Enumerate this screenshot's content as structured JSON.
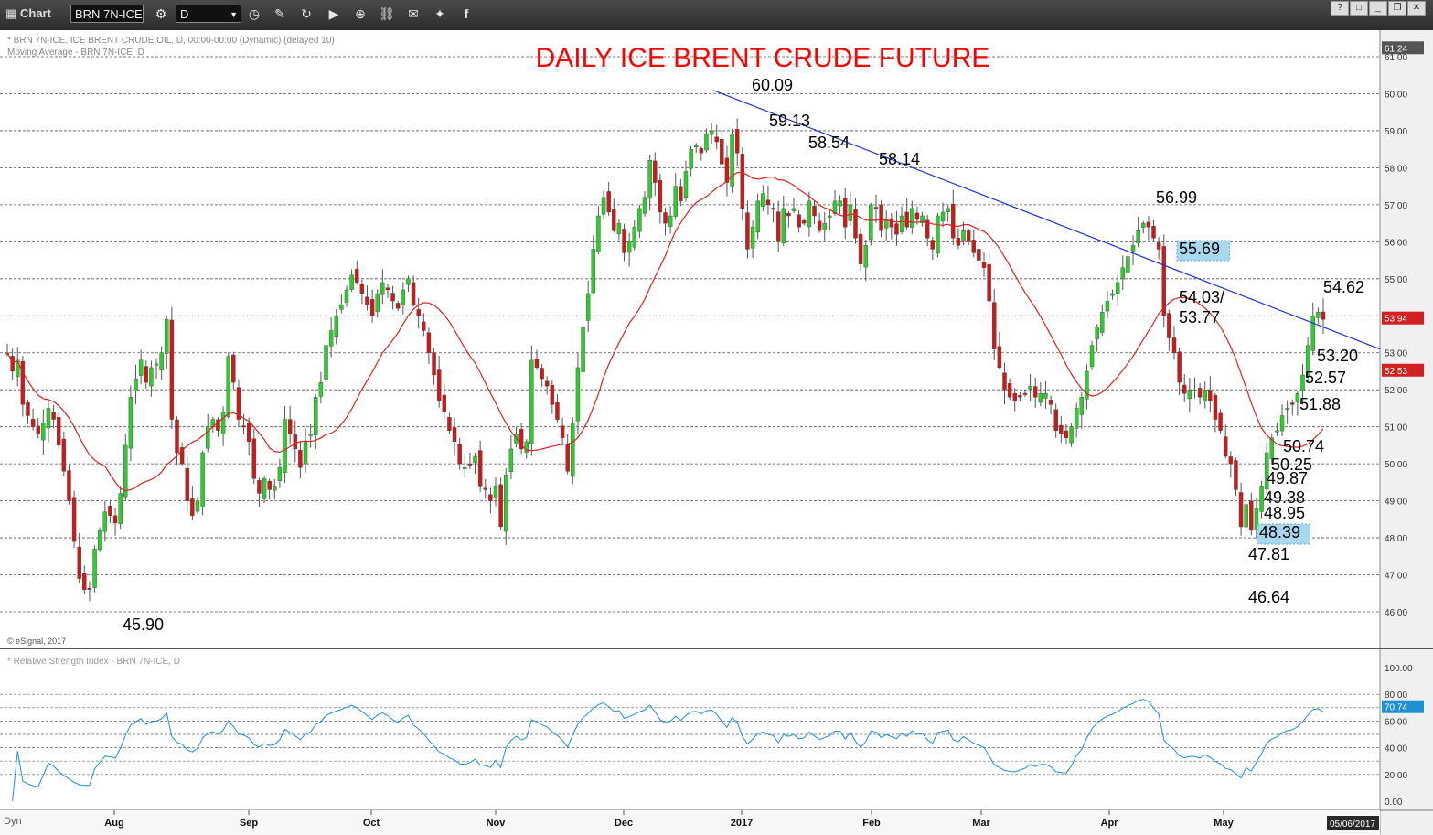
{
  "toolbar": {
    "app_label": "Chart",
    "symbol_value": "BRN 7N-ICE",
    "interval_value": "D"
  },
  "header": {
    "line1": "* BRN 7N-ICE, ICE BRENT CRUDE OIL, D, 00:00-00:00 (Dynamic) (delayed 10)",
    "line2": "Moving Average - BRN 7N-ICE, D"
  },
  "copyright": "© eSignal, 2017",
  "rsi_header": "* Relative Strength Index - BRN 7N-ICE, D",
  "bottom_left": "Dyn",
  "date_badge": "05/06/2017",
  "colors": {
    "up": "#2ecc2e",
    "down": "#cc1a1a",
    "ma": "#dd2222",
    "trend": "#2233cc",
    "rsi": "#1e90d6",
    "title": "#ff0000",
    "highlight": "#a8d8f0"
  },
  "chart_data": [
    {
      "type": "candlestick",
      "title": "DAILY ICE BRENT CRUDE FUTURE",
      "ylim": [
        45.5,
        61.5
      ],
      "y_ticks": [
        "46.00",
        "47.00",
        "48.00",
        "49.00",
        "50.00",
        "51.00",
        "52.00",
        "53.00",
        "54.00",
        "55.00",
        "56.00",
        "57.00",
        "58.00",
        "59.00",
        "60.00",
        "61.00"
      ],
      "x_labels": [
        "Aug",
        "Sep",
        "Oct",
        "Nov",
        "Dec",
        "2017",
        "Feb",
        "Mar",
        "Apr",
        "May"
      ],
      "grid": true,
      "price_tags": [
        {
          "label": "61.24",
          "value": 61.24
        },
        {
          "label": "53.94",
          "value": 53.94
        },
        {
          "label": "52.53",
          "value": 52.53
        }
      ],
      "close": [
        53.0,
        52.5,
        52.8,
        51.6,
        51.3,
        51.0,
        50.8,
        51.1,
        51.5,
        51.2,
        50.5,
        49.8,
        49.0,
        47.9,
        46.9,
        46.6,
        46.6,
        47.7,
        48.2,
        48.7,
        48.6,
        48.4,
        49.2,
        50.5,
        51.8,
        52.3,
        52.8,
        52.2,
        52.6,
        52.7,
        53.0,
        53.9,
        51.2,
        50.3,
        50.0,
        49.0,
        48.6,
        49.0,
        50.3,
        51.0,
        51.2,
        50.9,
        51.4,
        52.9,
        52.2,
        51.2,
        51.0,
        50.6,
        49.6,
        49.2,
        49.6,
        49.3,
        49.4,
        49.9,
        51.2,
        50.8,
        50.4,
        49.9,
        50.6,
        50.8,
        51.8,
        52.2,
        53.2,
        53.6,
        54.0,
        54.3,
        54.7,
        55.1,
        54.9,
        54.6,
        54.3,
        54.0,
        54.6,
        54.9,
        54.7,
        54.4,
        54.2,
        54.7,
        55.0,
        54.3,
        54.0,
        53.6,
        53.0,
        52.4,
        51.7,
        51.4,
        50.9,
        50.6,
        50.0,
        49.9,
        50.0,
        50.2,
        49.4,
        49.3,
        49.0,
        49.4,
        48.3,
        49.7,
        50.4,
        50.8,
        50.4,
        50.6,
        52.8,
        52.6,
        52.3,
        52.1,
        51.6,
        51.2,
        50.7,
        49.8,
        51.1,
        52.6,
        53.7,
        54.6,
        55.8,
        56.7,
        57.2,
        56.8,
        56.3,
        56.5,
        55.7,
        56.0,
        56.4,
        56.9,
        57.2,
        58.2,
        57.6,
        56.8,
        56.5,
        56.7,
        57.5,
        57.1,
        57.9,
        58.5,
        58.6,
        58.4,
        58.9,
        59.0,
        58.7,
        58.1,
        57.6,
        58.9,
        58.4,
        56.9,
        55.8,
        56.4,
        57.1,
        57.3,
        57.0,
        56.9,
        56.0,
        56.9,
        56.7,
        56.9,
        56.4,
        56.5,
        57.1,
        56.7,
        56.3,
        56.5,
        56.7,
        57.1,
        57.1,
        56.4,
        57.0,
        56.1,
        55.4,
        55.9,
        57.0,
        56.9,
        56.3,
        56.6,
        56.4,
        56.2,
        56.7,
        56.4,
        56.9,
        56.6,
        56.7,
        56.1,
        55.8,
        56.7,
        56.8,
        56.9,
        56.1,
        55.9,
        56.3,
        56.0,
        55.7,
        55.5,
        55.3,
        54.4,
        53.1,
        52.6,
        52.0,
        51.8,
        51.7,
        51.8,
        51.9,
        52.1,
        51.8,
        51.9,
        51.9,
        51.6,
        50.9,
        50.8,
        50.7,
        51.0,
        51.5,
        51.8,
        52.5,
        53.2,
        53.7,
        54.1,
        54.4,
        54.6,
        54.9,
        55.3,
        55.6,
        55.9,
        56.3,
        56.5,
        56.4,
        56.1,
        55.8,
        54.0,
        53.4,
        53.0,
        52.2,
        51.9,
        52.0,
        52.0,
        51.8,
        52.0,
        51.7,
        51.2,
        50.9,
        50.2,
        50.0,
        49.3,
        48.3,
        48.9,
        48.2,
        48.8,
        49.4,
        50.3,
        50.7,
        50.9,
        51.3,
        51.5,
        51.6,
        51.9,
        52.4,
        53.2,
        54.0,
        54.1,
        53.9
      ],
      "sma_period": 20,
      "trendline": {
        "from_value": 60.09,
        "to_value": 53.1
      },
      "annotations": [
        "60.09",
        "59.13",
        "58.54",
        "58.14",
        "56.99",
        "55.69",
        "54.62",
        "54.03/",
        "53.77",
        "53.20",
        "52.57",
        "51.88",
        "50.74",
        "50.25",
        "49.87",
        "49.38",
        "48.95",
        "48.39",
        "47.81",
        "46.64",
        "45.90"
      ],
      "highlighted": [
        "55.69",
        "48.39"
      ]
    },
    {
      "type": "line",
      "title": "Relative Strength Index",
      "ylim": [
        -5,
        105
      ],
      "y_ticks": [
        "0.00",
        "20.00",
        "40.00",
        "60.00",
        "80.00",
        "100.00"
      ],
      "last_value_tag": "70.74",
      "levels": [
        20,
        30,
        40,
        50,
        60,
        70,
        80
      ]
    }
  ]
}
